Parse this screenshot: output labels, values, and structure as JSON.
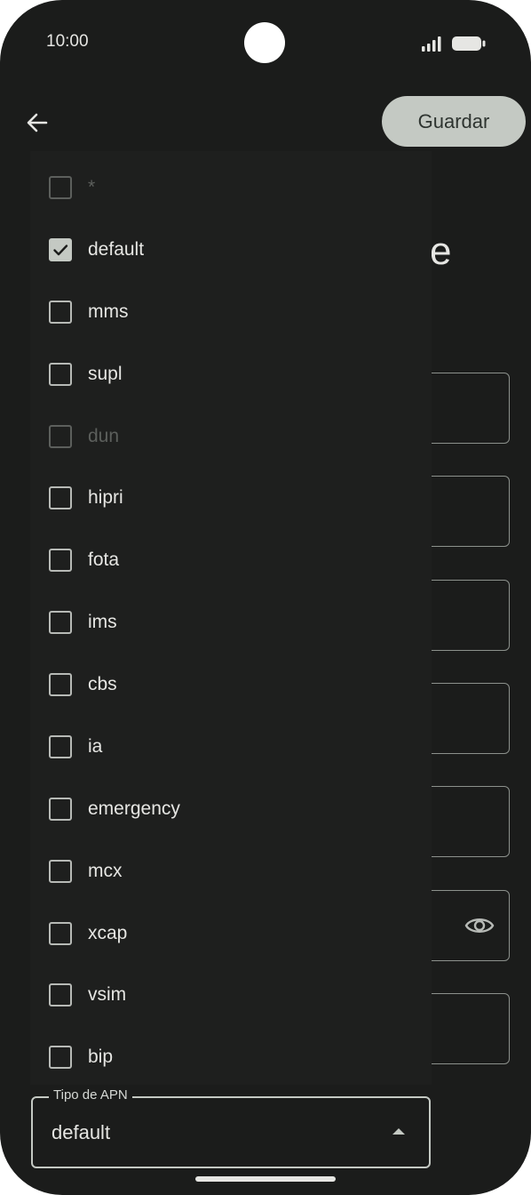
{
  "status_bar": {
    "time": "10:00"
  },
  "toolbar": {
    "save_label": "Guardar"
  },
  "background": {
    "title_fragment": "e"
  },
  "apn_type_menu": {
    "items": [
      {
        "label": "*",
        "checked": false,
        "enabled": false
      },
      {
        "label": "default",
        "checked": true,
        "enabled": true
      },
      {
        "label": "mms",
        "checked": false,
        "enabled": true
      },
      {
        "label": "supl",
        "checked": false,
        "enabled": true
      },
      {
        "label": "dun",
        "checked": false,
        "enabled": false
      },
      {
        "label": "hipri",
        "checked": false,
        "enabled": true
      },
      {
        "label": "fota",
        "checked": false,
        "enabled": true
      },
      {
        "label": "ims",
        "checked": false,
        "enabled": true
      },
      {
        "label": "cbs",
        "checked": false,
        "enabled": true
      },
      {
        "label": "ia",
        "checked": false,
        "enabled": true
      },
      {
        "label": "emergency",
        "checked": false,
        "enabled": true
      },
      {
        "label": "mcx",
        "checked": false,
        "enabled": true
      },
      {
        "label": "xcap",
        "checked": false,
        "enabled": true
      },
      {
        "label": "vsim",
        "checked": false,
        "enabled": true
      },
      {
        "label": "bip",
        "checked": false,
        "enabled": true
      }
    ]
  },
  "apn_type_field": {
    "label": "Tipo de APN",
    "value": "default"
  },
  "colors": {
    "background": "#1b1c1b",
    "menu": "#1e1f1e",
    "accent": "#c4c9c3",
    "text": "#e6e6e3",
    "disabled": "#5c5f5c"
  },
  "icons": [
    "back-arrow-icon",
    "signal-icon",
    "battery-icon",
    "eye-icon",
    "checkbox-checked-icon",
    "dropdown-arrow-up-icon"
  ]
}
